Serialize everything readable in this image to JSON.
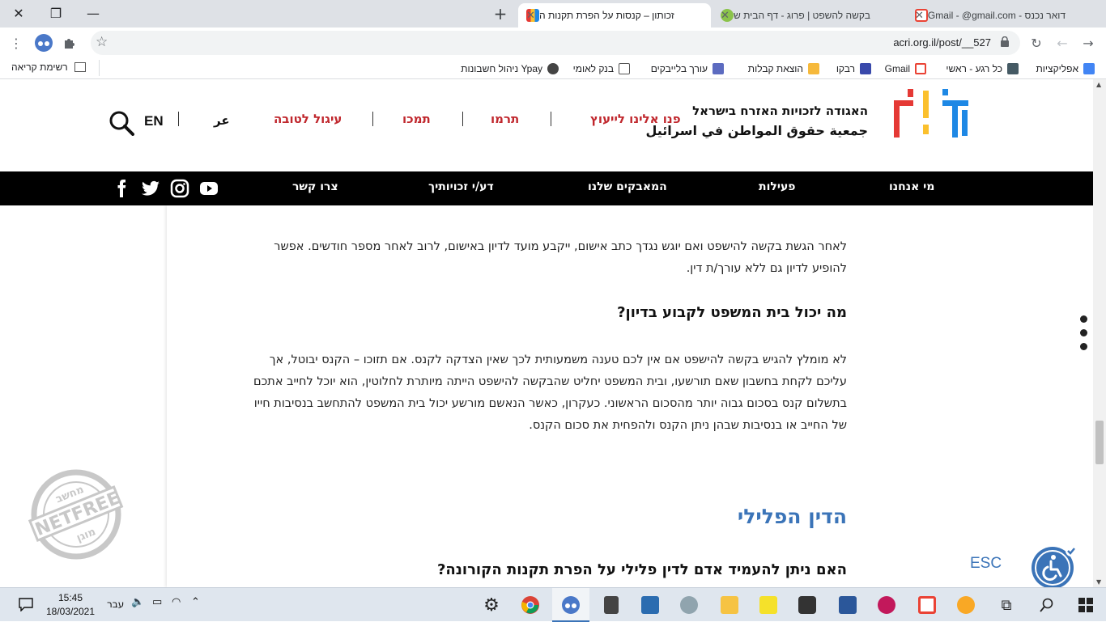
{
  "browser": {
    "tabs": [
      {
        "title": "דואר נכנס - Gmail - @gmail.com",
        "favicon_color": "#ea4335",
        "active": false
      },
      {
        "title": "בקשה להשפט | פרוג - דף הבית ש",
        "favicon_color": "#8bc34a",
        "active": false
      },
      {
        "title": "זכותון – קנסות על הפרת תקנות ה",
        "favicon_color": "#e53935",
        "active": true
      }
    ],
    "close_glyph": "✕",
    "new_tab_glyph": "+",
    "window": {
      "minimize": "—",
      "restore": "❐",
      "close": "✕"
    },
    "url": "acri.org.il/post/__527",
    "bookmarks": [
      {
        "label": "אפליקציות",
        "color": "#4285f4"
      },
      {
        "label": "כל רגע - ראשי",
        "color": "#455a64"
      },
      {
        "label": "Gmail",
        "color": "#ea4335"
      },
      {
        "label": "רבקו",
        "color": "#3949ab"
      },
      {
        "label": "הוצאת קבלות",
        "color": "#f6b93b"
      },
      {
        "label": "עורך בלייבקים",
        "color": "#5c6bc0"
      },
      {
        "label": "בנק לאומי",
        "color": "#555555"
      },
      {
        "label": "ניהול חשבונות Ypay",
        "color": "#444444"
      }
    ],
    "reading_list": "רשימת קריאה"
  },
  "site": {
    "logo": {
      "hebrew": "האגודה לזכויות האזרח בישראל",
      "arabic": "جمعية حقوق المواطن في اسرائيل"
    },
    "header_links": [
      "פנו אלינו לייעוץ",
      "תרמו",
      "תמכו",
      "עיגול לטובה"
    ],
    "lang_ar": "عر",
    "lang_en": "EN",
    "main_nav": [
      "מי אנחנו",
      "פעילות",
      "המאבקים שלנו",
      "דע/י זכויותיך",
      "צרו קשר"
    ]
  },
  "article": {
    "para1": "לאחר הגשת בקשה להישפט ואם יוגש נגדך כתב אישום, ייקבע מועד לדיון באישום, לרוב לאחר מספר חודשים. אפשר להופיע לדיון גם ללא עורך/ת דין.",
    "q1": "מה יכול בית המשפט לקבוע בדיון?",
    "para2": "לא מומלץ להגיש בקשה להישפט אם אין לכם טענה משמעותית לכך שאין הצדקה לקנס. אם תזוכו – הקנס יבוטל, אך עליכם לקחת בחשבון שאם תורשעו, ובית המשפט יחליט שהבקשה להישפט הייתה מיותרת לחלוטין, הוא יוכל לחייב אתכם בתשלום קנס בסכום גבוה יותר מהסכום הראשוני. כעקרון, כאשר הנאשם מורשע יכול בית המשפט להתחשב בנסיבות חייו של החייב או בנסיבות שבהן ניתן הקנס ולהפחית את סכום הקנס.",
    "section": "הדין הפלילי",
    "q2": "האם ניתן להעמיד אדם לדין פלילי על הפרת תקנות הקורונה?"
  },
  "overlays": {
    "esc": "ESC",
    "netfree": {
      "top": "מחשב",
      "middle": "NETFREE",
      "bottom": "מוגן"
    }
  },
  "taskbar": {
    "time": "15:45",
    "date": "18/03/2021",
    "lang": "עבר"
  }
}
